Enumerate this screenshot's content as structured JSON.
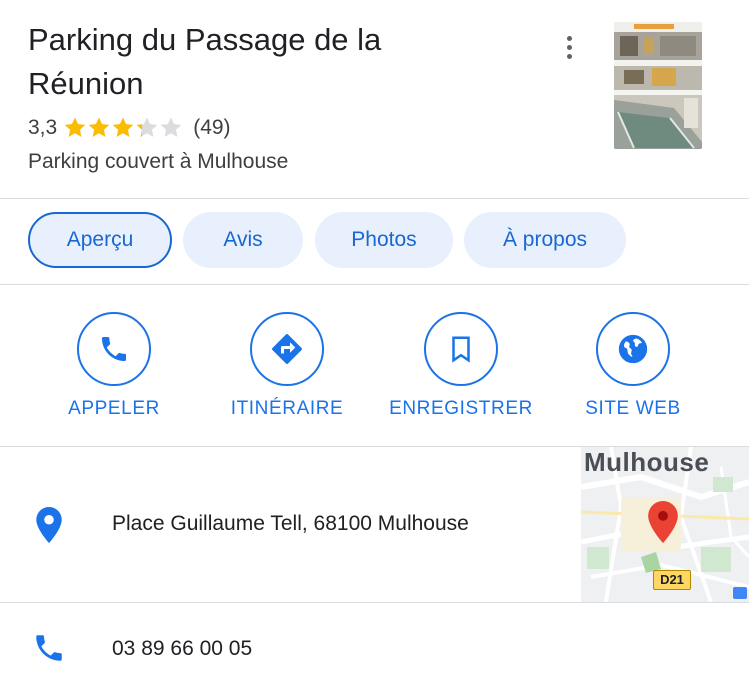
{
  "place": {
    "title": "Parking du Passage de la Réunion",
    "rating": "3,3",
    "rating_value": 3.3,
    "rating_max": 5,
    "review_count": "(49)",
    "category": "Parking couvert à Mulhouse",
    "menu_icon": "more-vert-icon",
    "photo_icon": "place-photo-thumbnail"
  },
  "tabs": [
    {
      "label": "Aperçu",
      "active": true
    },
    {
      "label": "Avis",
      "active": false
    },
    {
      "label": "Photos",
      "active": false
    },
    {
      "label": "À propos",
      "active": false
    }
  ],
  "actions": [
    {
      "label": "APPELER",
      "icon": "phone-icon"
    },
    {
      "label": "ITINÉRAIRE",
      "icon": "directions-icon"
    },
    {
      "label": "ENREGISTRER",
      "icon": "bookmark-icon"
    },
    {
      "label": "SITE WEB",
      "icon": "globe-icon"
    }
  ],
  "address": {
    "text": "Place Guillaume Tell, 68100 Mulhouse",
    "icon": "location-pin-icon",
    "map_city": "Mulhouse",
    "map_road": "D21"
  },
  "phone": {
    "text": "03 89 66 00 05",
    "icon": "phone-icon"
  },
  "colors": {
    "accent": "#1a73e8",
    "tab_bg": "#e8f0fe",
    "star": "#fbbc04",
    "pin_red": "#ea4335",
    "divider": "#dadce0"
  }
}
